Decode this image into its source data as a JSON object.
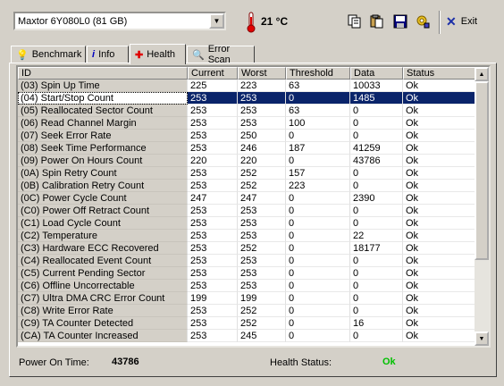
{
  "toolbar": {
    "drive": "Maxtor 6Y080L0   (81 GB)",
    "temperature": "21 °C",
    "exit_label": "Exit"
  },
  "tabs": [
    {
      "label": "Benchmark"
    },
    {
      "label": "Info"
    },
    {
      "label": "Health"
    },
    {
      "label": "Error Scan"
    }
  ],
  "grid": {
    "columns": [
      "ID",
      "Current",
      "Worst",
      "Threshold",
      "Data",
      "Status"
    ],
    "rows": [
      [
        "(03) Spin Up Time",
        "225",
        "223",
        "63",
        "10033",
        "Ok"
      ],
      [
        "(04) Start/Stop Count",
        "253",
        "253",
        "0",
        "1485",
        "Ok"
      ],
      [
        "(05) Reallocated Sector Count",
        "253",
        "253",
        "63",
        "0",
        "Ok"
      ],
      [
        "(06) Read Channel Margin",
        "253",
        "253",
        "100",
        "0",
        "Ok"
      ],
      [
        "(07) Seek Error Rate",
        "253",
        "250",
        "0",
        "0",
        "Ok"
      ],
      [
        "(08) Seek Time Performance",
        "253",
        "246",
        "187",
        "41259",
        "Ok"
      ],
      [
        "(09) Power On Hours Count",
        "220",
        "220",
        "0",
        "43786",
        "Ok"
      ],
      [
        "(0A) Spin Retry Count",
        "253",
        "252",
        "157",
        "0",
        "Ok"
      ],
      [
        "(0B) Calibration Retry Count",
        "253",
        "252",
        "223",
        "0",
        "Ok"
      ],
      [
        "(0C) Power Cycle Count",
        "247",
        "247",
        "0",
        "2390",
        "Ok"
      ],
      [
        "(C0) Power Off Retract Count",
        "253",
        "253",
        "0",
        "0",
        "Ok"
      ],
      [
        "(C1) Load Cycle Count",
        "253",
        "253",
        "0",
        "0",
        "Ok"
      ],
      [
        "(C2) Temperature",
        "253",
        "253",
        "0",
        "22",
        "Ok"
      ],
      [
        "(C3) Hardware ECC Recovered",
        "253",
        "252",
        "0",
        "18177",
        "Ok"
      ],
      [
        "(C4) Reallocated Event Count",
        "253",
        "253",
        "0",
        "0",
        "Ok"
      ],
      [
        "(C5) Current Pending Sector",
        "253",
        "253",
        "0",
        "0",
        "Ok"
      ],
      [
        "(C6) Offline Uncorrectable",
        "253",
        "253",
        "0",
        "0",
        "Ok"
      ],
      [
        "(C7) Ultra DMA CRC Error Count",
        "199",
        "199",
        "0",
        "0",
        "Ok"
      ],
      [
        "(C8) Write Error Rate",
        "253",
        "252",
        "0",
        "0",
        "Ok"
      ],
      [
        "(C9) TA Counter Detected",
        "253",
        "252",
        "0",
        "16",
        "Ok"
      ],
      [
        "(CA) TA Counter Increased",
        "253",
        "245",
        "0",
        "0",
        "Ok"
      ]
    ]
  },
  "status": {
    "power_on_label": "Power On Time:",
    "power_on_value": "43786",
    "health_label": "Health Status:",
    "health_value": "Ok"
  },
  "colors": {
    "selection": "#0a246a",
    "health_ok": "#00c000"
  }
}
